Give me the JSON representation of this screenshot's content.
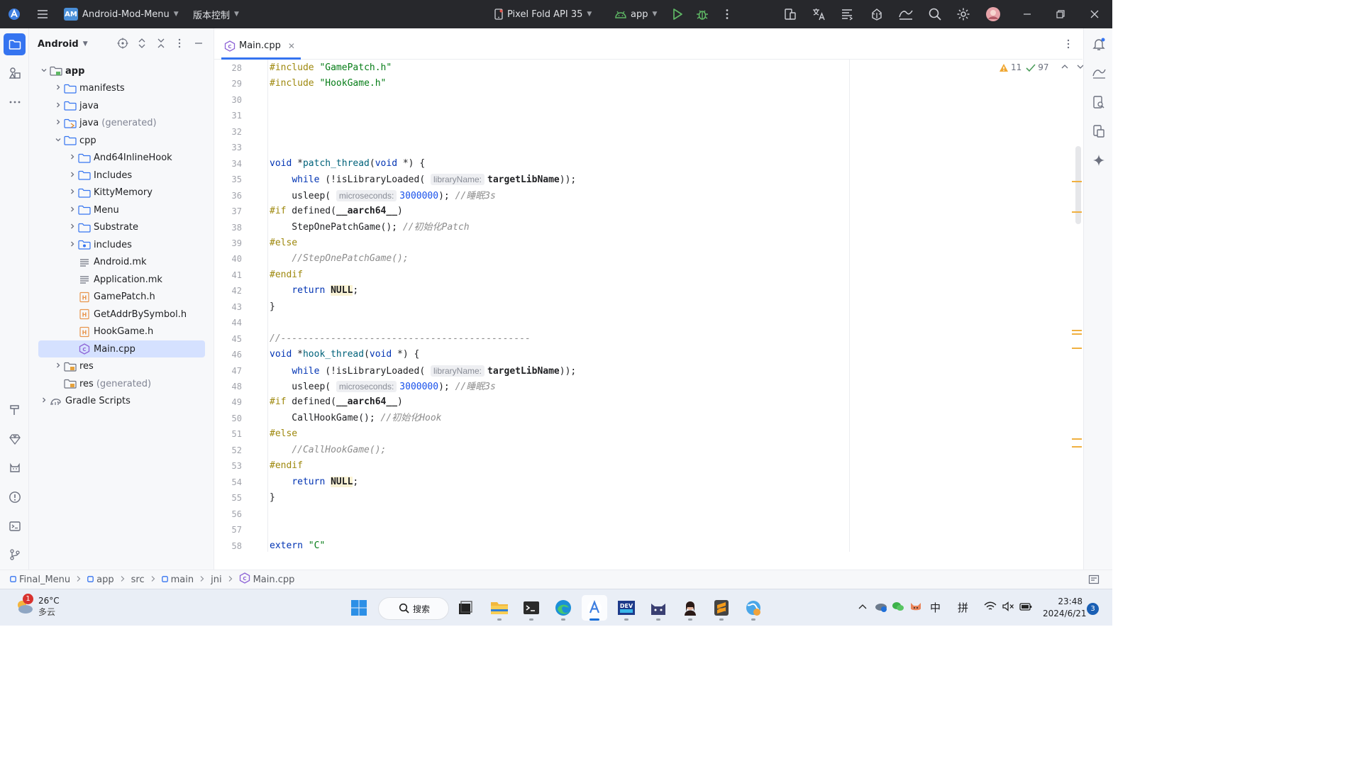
{
  "titlebar": {
    "project_badge": "AM",
    "project_name": "Android-Mod-Menu",
    "vcs_label": "版本控制",
    "device": "Pixel Fold API 35",
    "run_config": "app"
  },
  "project_panel": {
    "view_label": "Android",
    "tree": [
      {
        "label": "app",
        "suffix": "",
        "depth": 0,
        "arrow": "down",
        "icon": "module-folder-icon",
        "bold": true
      },
      {
        "label": "manifests",
        "suffix": "",
        "depth": 1,
        "arrow": "right",
        "icon": "folder-icon"
      },
      {
        "label": "java",
        "suffix": "",
        "depth": 1,
        "arrow": "right",
        "icon": "folder-icon"
      },
      {
        "label": "java",
        "suffix": "(generated)",
        "depth": 1,
        "arrow": "right",
        "icon": "generated-folder-icon"
      },
      {
        "label": "cpp",
        "suffix": "",
        "depth": 1,
        "arrow": "down",
        "icon": "folder-icon"
      },
      {
        "label": "And64InlineHook",
        "suffix": "",
        "depth": 2,
        "arrow": "right",
        "icon": "folder-icon"
      },
      {
        "label": "Includes",
        "suffix": "",
        "depth": 2,
        "arrow": "right",
        "icon": "folder-icon"
      },
      {
        "label": "KittyMemory",
        "suffix": "",
        "depth": 2,
        "arrow": "right",
        "icon": "folder-icon"
      },
      {
        "label": "Menu",
        "suffix": "",
        "depth": 2,
        "arrow": "right",
        "icon": "folder-icon"
      },
      {
        "label": "Substrate",
        "suffix": "",
        "depth": 2,
        "arrow": "right",
        "icon": "folder-icon"
      },
      {
        "label": "includes",
        "suffix": "",
        "depth": 2,
        "arrow": "right",
        "icon": "include-folder-icon"
      },
      {
        "label": "Android.mk",
        "suffix": "",
        "depth": 2,
        "arrow": "",
        "icon": "text-file-icon"
      },
      {
        "label": "Application.mk",
        "suffix": "",
        "depth": 2,
        "arrow": "",
        "icon": "text-file-icon"
      },
      {
        "label": "GamePatch.h",
        "suffix": "",
        "depth": 2,
        "arrow": "",
        "icon": "header-file-icon"
      },
      {
        "label": "GetAddrBySymbol.h",
        "suffix": "",
        "depth": 2,
        "arrow": "",
        "icon": "header-file-icon"
      },
      {
        "label": "HookGame.h",
        "suffix": "",
        "depth": 2,
        "arrow": "",
        "icon": "header-file-icon"
      },
      {
        "label": "Main.cpp",
        "suffix": "",
        "depth": 2,
        "arrow": "",
        "icon": "cpp-file-icon",
        "selected": true
      },
      {
        "label": "res",
        "suffix": "",
        "depth": 1,
        "arrow": "right",
        "icon": "res-folder-icon"
      },
      {
        "label": "res",
        "suffix": "(generated)",
        "depth": 1,
        "arrow": "",
        "icon": "res-folder-icon"
      },
      {
        "label": "Gradle Scripts",
        "suffix": "",
        "depth": 0,
        "arrow": "right",
        "icon": "gradle-icon"
      }
    ]
  },
  "editor": {
    "tab_label": "Main.cpp",
    "warnings": "11",
    "checks": "97",
    "lines": [
      {
        "n": "28",
        "tokens": [
          [
            "pp",
            "#include "
          ],
          [
            "str",
            "\"GamePatch.h\""
          ]
        ]
      },
      {
        "n": "29",
        "tokens": [
          [
            "pp",
            "#include "
          ],
          [
            "str",
            "\"HookGame.h\""
          ]
        ]
      },
      {
        "n": "30",
        "tokens": []
      },
      {
        "n": "31",
        "tokens": []
      },
      {
        "n": "32",
        "tokens": []
      },
      {
        "n": "33",
        "tokens": []
      },
      {
        "n": "34",
        "tokens": [
          [
            "kw",
            "void"
          ],
          [
            "",
            " *"
          ],
          [
            "fn",
            "patch_thread"
          ],
          [
            "",
            "("
          ],
          [
            "kw",
            "void"
          ],
          [
            "",
            " *) {"
          ]
        ]
      },
      {
        "n": "35",
        "tokens": [
          [
            "",
            "    "
          ],
          [
            "kw",
            "while"
          ],
          [
            "",
            " (!isLibraryLoaded( "
          ],
          [
            "hint",
            "libraryName:"
          ],
          [
            "gl",
            "targetLibName"
          ],
          [
            "",
            "));"
          ]
        ]
      },
      {
        "n": "36",
        "tokens": [
          [
            "",
            "    usleep( "
          ],
          [
            "hint",
            "microseconds:"
          ],
          [
            "num",
            "3000000"
          ],
          [
            "",
            "); "
          ],
          [
            "cm",
            "//睡眠3s"
          ]
        ]
      },
      {
        "n": "37",
        "tokens": [
          [
            "pp",
            "#if"
          ],
          [
            "",
            " defined("
          ],
          [
            "gl",
            "__aarch64__"
          ],
          [
            "",
            ")"
          ]
        ]
      },
      {
        "n": "38",
        "tokens": [
          [
            "",
            "    StepOnePatchGame(); "
          ],
          [
            "cm",
            "//初始化Patch"
          ]
        ]
      },
      {
        "n": "39",
        "tokens": [
          [
            "pp",
            "#else"
          ]
        ]
      },
      {
        "n": "40",
        "tokens": [
          [
            "",
            "    "
          ],
          [
            "cm",
            "//StepOnePatchGame();"
          ]
        ]
      },
      {
        "n": "41",
        "tokens": [
          [
            "pp",
            "#endif"
          ]
        ]
      },
      {
        "n": "42",
        "tokens": [
          [
            "",
            "    "
          ],
          [
            "kw",
            "return"
          ],
          [
            "",
            " "
          ],
          [
            "nullh",
            "NULL"
          ],
          [
            "",
            ";"
          ]
        ]
      },
      {
        "n": "43",
        "tokens": [
          [
            "",
            "}"
          ]
        ]
      },
      {
        "n": "44",
        "tokens": []
      },
      {
        "n": "45",
        "tokens": [
          [
            "cm",
            "//---------------------------------------------"
          ]
        ]
      },
      {
        "n": "46",
        "tokens": [
          [
            "kw",
            "void"
          ],
          [
            "",
            " *"
          ],
          [
            "fn",
            "hook_thread"
          ],
          [
            "",
            "("
          ],
          [
            "kw",
            "void"
          ],
          [
            "",
            " *) {"
          ]
        ]
      },
      {
        "n": "47",
        "tokens": [
          [
            "",
            "    "
          ],
          [
            "kw",
            "while"
          ],
          [
            "",
            " (!isLibraryLoaded( "
          ],
          [
            "hint",
            "libraryName:"
          ],
          [
            "gl",
            "targetLibName"
          ],
          [
            "",
            "));"
          ]
        ]
      },
      {
        "n": "48",
        "tokens": [
          [
            "",
            "    usleep( "
          ],
          [
            "hint",
            "microseconds:"
          ],
          [
            "num",
            "3000000"
          ],
          [
            "",
            "); "
          ],
          [
            "cm",
            "//睡眠3s"
          ]
        ]
      },
      {
        "n": "49",
        "tokens": [
          [
            "pp",
            "#if"
          ],
          [
            "",
            " defined("
          ],
          [
            "gl",
            "__aarch64__"
          ],
          [
            "",
            ")"
          ]
        ]
      },
      {
        "n": "50",
        "tokens": [
          [
            "",
            "    CallHookGame(); "
          ],
          [
            "cm",
            "//初始化Hook"
          ]
        ]
      },
      {
        "n": "51",
        "tokens": [
          [
            "pp",
            "#else"
          ]
        ]
      },
      {
        "n": "52",
        "tokens": [
          [
            "",
            "    "
          ],
          [
            "cm",
            "//CallHookGame();"
          ]
        ]
      },
      {
        "n": "53",
        "tokens": [
          [
            "pp",
            "#endif"
          ]
        ]
      },
      {
        "n": "54",
        "tokens": [
          [
            "",
            "    "
          ],
          [
            "kw",
            "return"
          ],
          [
            "",
            " "
          ],
          [
            "nullh",
            "NULL"
          ],
          [
            "",
            ";"
          ]
        ]
      },
      {
        "n": "55",
        "tokens": [
          [
            "",
            "}"
          ]
        ]
      },
      {
        "n": "56",
        "tokens": []
      },
      {
        "n": "57",
        "tokens": []
      },
      {
        "n": "58",
        "tokens": [
          [
            "kw",
            "extern"
          ],
          [
            "",
            " "
          ],
          [
            "str",
            "\"C\""
          ]
        ]
      }
    ]
  },
  "statusbar": {
    "breadcrumbs": [
      "Final_Menu",
      "app",
      "src",
      "main",
      "jni",
      "Main.cpp"
    ]
  },
  "taskbar": {
    "weather_temp": "26°C",
    "weather_desc": "多云",
    "weather_badge": "1",
    "search_label": "搜索",
    "ime_lang": "中",
    "ime_mode": "拼",
    "time": "23:48",
    "date": "2024/6/21",
    "notif_count": "3"
  },
  "colors": {
    "accent": "#3574f0",
    "titlebar_bg": "#27282c",
    "selection": "#d5e1ff",
    "warning_mark": "#f0b040"
  }
}
